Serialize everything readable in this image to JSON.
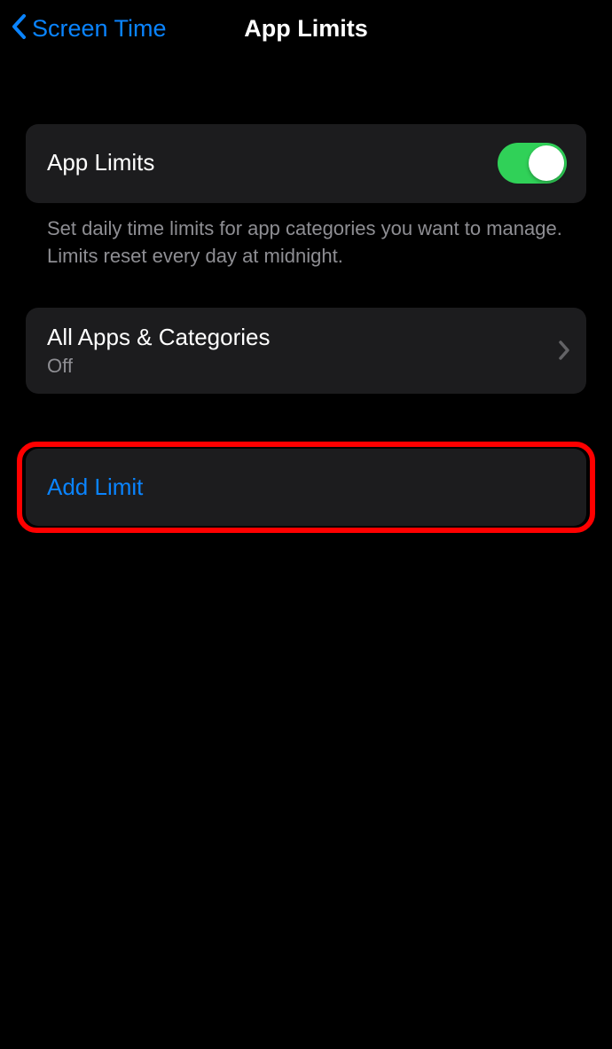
{
  "nav": {
    "back_label": "Screen Time",
    "title": "App Limits"
  },
  "toggle_section": {
    "title": "App Limits",
    "enabled": true,
    "footer": "Set daily time limits for app categories you want to manage. Limits reset every day at midnight."
  },
  "all_apps": {
    "title": "All Apps & Categories",
    "status": "Off"
  },
  "add_limit": {
    "label": "Add Limit"
  }
}
